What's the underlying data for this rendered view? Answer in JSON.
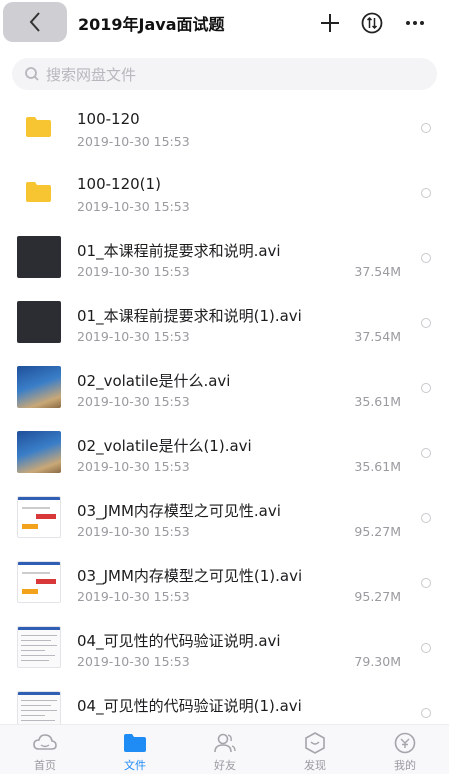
{
  "header": {
    "title": "2019年Java面试题",
    "back_icon": "chevron-left-icon",
    "add_icon": "plus-icon",
    "sort_icon": "sort-icon",
    "more_icon": "more-icon"
  },
  "search": {
    "placeholder": "搜索网盘文件"
  },
  "files": [
    {
      "name": "100-120",
      "date": "2019-10-30 15:53",
      "size": "",
      "type": "folder"
    },
    {
      "name": "100-120(1)",
      "date": "2019-10-30 15:53",
      "size": "",
      "type": "folder"
    },
    {
      "name": "01_本课程前提要求和说明.avi",
      "date": "2019-10-30 15:53",
      "size": "37.54M",
      "type": "video-dark"
    },
    {
      "name": "01_本课程前提要求和说明(1).avi",
      "date": "2019-10-30 15:53",
      "size": "37.54M",
      "type": "video-dark"
    },
    {
      "name": "02_volatile是什么.avi",
      "date": "2019-10-30 15:53",
      "size": "35.61M",
      "type": "video-sky"
    },
    {
      "name": "02_volatile是什么(1).avi",
      "date": "2019-10-30 15:53",
      "size": "35.61M",
      "type": "video-sky"
    },
    {
      "name": "03_JMM内存模型之可见性.avi",
      "date": "2019-10-30 15:53",
      "size": "95.27M",
      "type": "video-doc"
    },
    {
      "name": "03_JMM内存模型之可见性(1).avi",
      "date": "2019-10-30 15:53",
      "size": "95.27M",
      "type": "video-doc"
    },
    {
      "name": "04_可见性的代码验证说明.avi",
      "date": "2019-10-30 15:53",
      "size": "79.30M",
      "type": "video-code"
    },
    {
      "name": "04_可见性的代码验证说明(1).avi",
      "date": "",
      "size": "",
      "type": "video-code"
    }
  ],
  "tabs": [
    {
      "label": "首页",
      "icon": "cloud-icon",
      "active": false
    },
    {
      "label": "文件",
      "icon": "folder-icon",
      "active": true
    },
    {
      "label": "好友",
      "icon": "friends-icon",
      "active": false
    },
    {
      "label": "发现",
      "icon": "discover-icon",
      "active": false
    },
    {
      "label": "我的",
      "icon": "profile-icon",
      "active": false
    }
  ],
  "colors": {
    "accent": "#1f8bf5",
    "folder": "#f7c531",
    "text": "#1c1c1e",
    "secondary": "#9a9aa0"
  }
}
